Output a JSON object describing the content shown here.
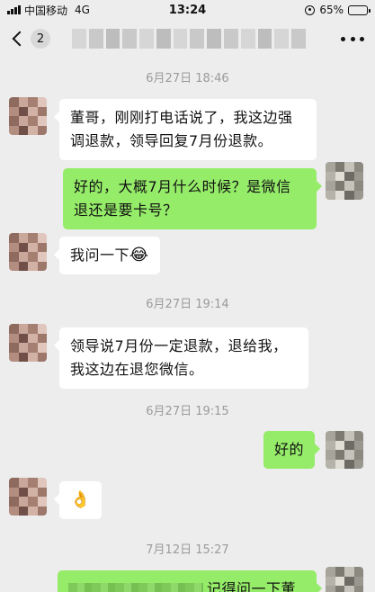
{
  "status_bar": {
    "carrier": "中国移动",
    "network": "4G",
    "time": "13:24",
    "battery": "65%",
    "battery_level": 0.65
  },
  "nav": {
    "unread_count": "2",
    "icons": {
      "back": "chevron-left-icon",
      "more": "ellipsis-icon"
    }
  },
  "chat": {
    "timestamps": [
      "6月27日 18:46",
      "6月27日 19:14",
      "6月27日 19:15",
      "7月12日 15:27"
    ],
    "messages": [
      {
        "side": "in",
        "text": "董哥，刚刚打电话说了，我这边强调退款，领导回复7月份退款。"
      },
      {
        "side": "out",
        "text": "好的，大概7月什么时候？是微信退还是要卡号？"
      },
      {
        "side": "in",
        "text": "我问一下",
        "emoji": "😂"
      },
      {
        "side": "in",
        "text": "领导说7月份一定退款，退给我，我这边在退您微信。"
      },
      {
        "side": "out",
        "text": "好的"
      },
      {
        "side": "in",
        "text": "",
        "emoji": "👌"
      },
      {
        "side": "out",
        "text": "记得问一下董哥"
      }
    ]
  },
  "colors": {
    "background": "#ededed",
    "incoming_bubble": "#ffffff",
    "outgoing_bubble": "#95ec69",
    "timestamp_text": "#9b9b9b"
  }
}
